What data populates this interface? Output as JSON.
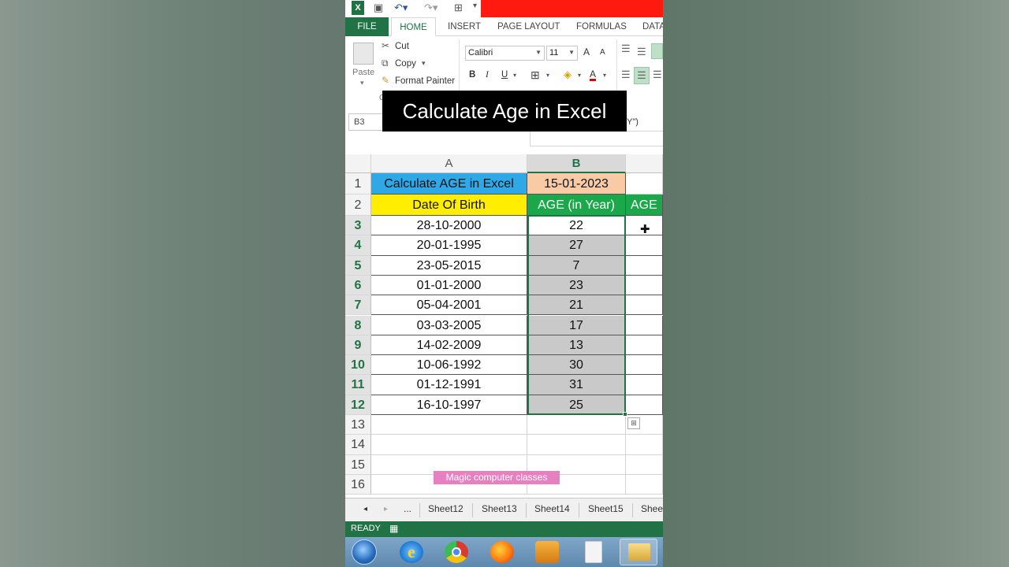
{
  "ribbon": {
    "tabs": [
      "FILE",
      "HOME",
      "INSERT",
      "PAGE LAYOUT",
      "FORMULAS",
      "DATA"
    ],
    "clipboard": {
      "paste": "Paste",
      "cut": "Cut",
      "copy": "Copy",
      "format_painter": "Format Painter",
      "group_fragment": "C"
    },
    "font": {
      "name": "Calibri",
      "size": "11",
      "grow": "A",
      "shrink": "A",
      "bold": "B",
      "italic": "I",
      "underline": "U",
      "font_color": "A"
    }
  },
  "formula_bar": {
    "name_box": "B3",
    "formula_fragment": "Y\")"
  },
  "title_banner": "Calculate Age in Excel",
  "sheet": {
    "columns": [
      "A",
      "B"
    ],
    "rows": [
      {
        "n": "1",
        "a": "Calculate AGE in Excel",
        "b": "15-01-2023",
        "c": ""
      },
      {
        "n": "2",
        "a": "Date Of Birth",
        "b": "AGE (in Year)",
        "c": "AGE"
      },
      {
        "n": "3",
        "a": "28-10-2000",
        "b": "22",
        "c": ""
      },
      {
        "n": "4",
        "a": "20-01-1995",
        "b": "27",
        "c": ""
      },
      {
        "n": "5",
        "a": "23-05-2015",
        "b": "7",
        "c": ""
      },
      {
        "n": "6",
        "a": "01-01-2000",
        "b": "23",
        "c": ""
      },
      {
        "n": "7",
        "a": "05-04-2001",
        "b": "21",
        "c": ""
      },
      {
        "n": "8",
        "a": "03-03-2005",
        "b": "17",
        "c": ""
      },
      {
        "n": "9",
        "a": "14-02-2009",
        "b": "13",
        "c": ""
      },
      {
        "n": "10",
        "a": "10-06-1992",
        "b": "30",
        "c": ""
      },
      {
        "n": "11",
        "a": "01-12-1991",
        "b": "31",
        "c": ""
      },
      {
        "n": "12",
        "a": "16-10-1997",
        "b": "25",
        "c": ""
      },
      {
        "n": "13",
        "a": "",
        "b": "",
        "c": ""
      },
      {
        "n": "14",
        "a": "",
        "b": "",
        "c": ""
      },
      {
        "n": "15",
        "a": "",
        "b": "",
        "c": ""
      },
      {
        "n": "16",
        "a": "",
        "b": "",
        "c": ""
      }
    ]
  },
  "watermark": "Magic computer classes",
  "sheet_tabs": {
    "prev": "◂",
    "next": "▸",
    "more": "...",
    "tabs": [
      "Sheet12",
      "Sheet13",
      "Sheet14",
      "Sheet15",
      "Shee"
    ]
  },
  "status": {
    "text": "READY"
  },
  "colors": {
    "excel_green": "#217346",
    "header_blue": "#2fa8e8",
    "header_peach": "#f8cba6",
    "header_yellow": "#ffee00",
    "header_green": "#1aa84a",
    "selection_gray": "#c9c9c9",
    "red_bar": "#ff1a0f",
    "watermark_pink": "#e680c0"
  },
  "icons": [
    "excel-logo-icon",
    "save-icon",
    "undo-icon",
    "redo-icon",
    "borders-icon",
    "cut-icon",
    "copy-icon",
    "format-painter-icon",
    "paste-icon",
    "align-icon",
    "fill-color-icon",
    "quick-analysis-icon",
    "cell-cursor-icon",
    "start-icon",
    "ie-icon",
    "chrome-icon",
    "firefox-icon",
    "media-player-icon",
    "file-icon",
    "folder-icon"
  ]
}
